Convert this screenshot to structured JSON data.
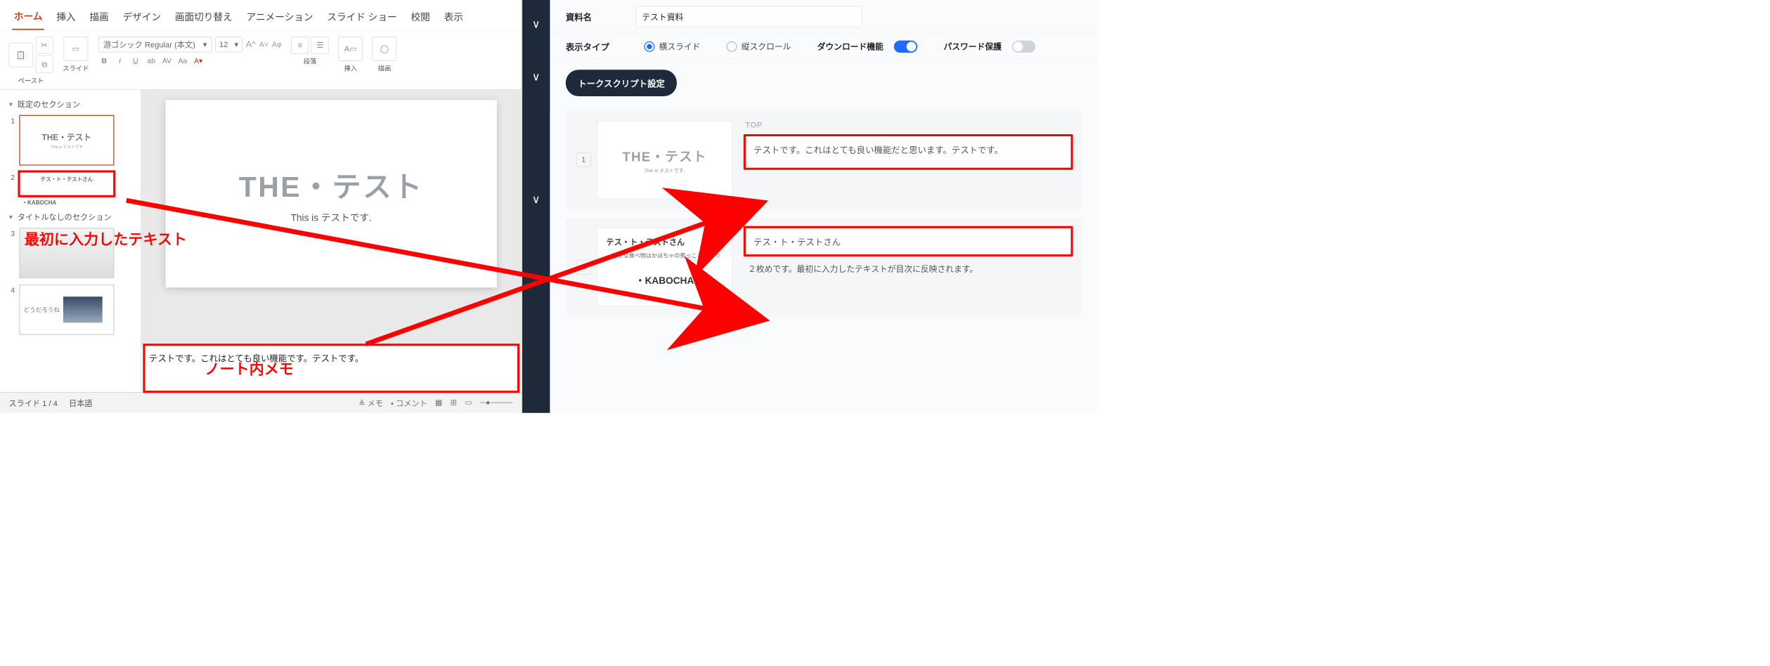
{
  "powerpoint": {
    "tabs": [
      "ホーム",
      "挿入",
      "描画",
      "デザイン",
      "画面切り替え",
      "アニメーション",
      "スライド ショー",
      "校閲",
      "表示"
    ],
    "active_tab": "ホーム",
    "groups": {
      "paste": "ペースト",
      "slide": "スライド",
      "paragraph": "段落",
      "insert": "挿入",
      "draw": "描画"
    },
    "font_name": "游ゴシック Regular (本文)",
    "font_size": "12",
    "sections": {
      "default": "既定のセクション",
      "untitled": "タイトルなしのセクション"
    },
    "thumbs": {
      "1": {
        "title": "THE・テスト",
        "sub": "This is テストです"
      },
      "2": {
        "title": "テス・ト・テストさん",
        "kabocha": "・KABOCHA"
      },
      "3": {
        "title": ""
      },
      "4": {
        "title": "どうだろうね"
      }
    },
    "canvas": {
      "title": "THE・テスト",
      "sub": "This is テストです."
    },
    "notes": "テストです。これはとても良い機能です。テストです。",
    "status": {
      "slide": "スライド 1 / 4",
      "lang": "日本語",
      "memo": "メモ",
      "comment": "コメント"
    }
  },
  "right": {
    "doc_name_label": "資料名",
    "doc_name_value": "テスト資料",
    "display_type_label": "表示タイプ",
    "opt_horizontal": "横スライド",
    "opt_vertical": "縦スクロール",
    "download_label": "ダウンロード機能",
    "password_label": "パスワード保護",
    "talkscript_btn": "トークスクリプト設定",
    "top_label": "TOP",
    "card1": {
      "num": "1",
      "thumb_title": "THE・テスト",
      "thumb_sub": "This is テストです.",
      "text": "テストです。これはとても良い機能だと思います。テストです。"
    },
    "card2": {
      "num": "2",
      "line1": "テス・ト・テストさん",
      "line2": "・好きな食べ物はかぼちゃの煮っころがし ☺",
      "line3": "・KABOCHA",
      "text": "テス・ト・テストさん",
      "desc": "２枚めです。最初に入力したテキストが目次に反映されます。"
    }
  },
  "annotations": {
    "first_text": "最初に入力したテキスト",
    "note_memo": "ノート内メモ"
  }
}
